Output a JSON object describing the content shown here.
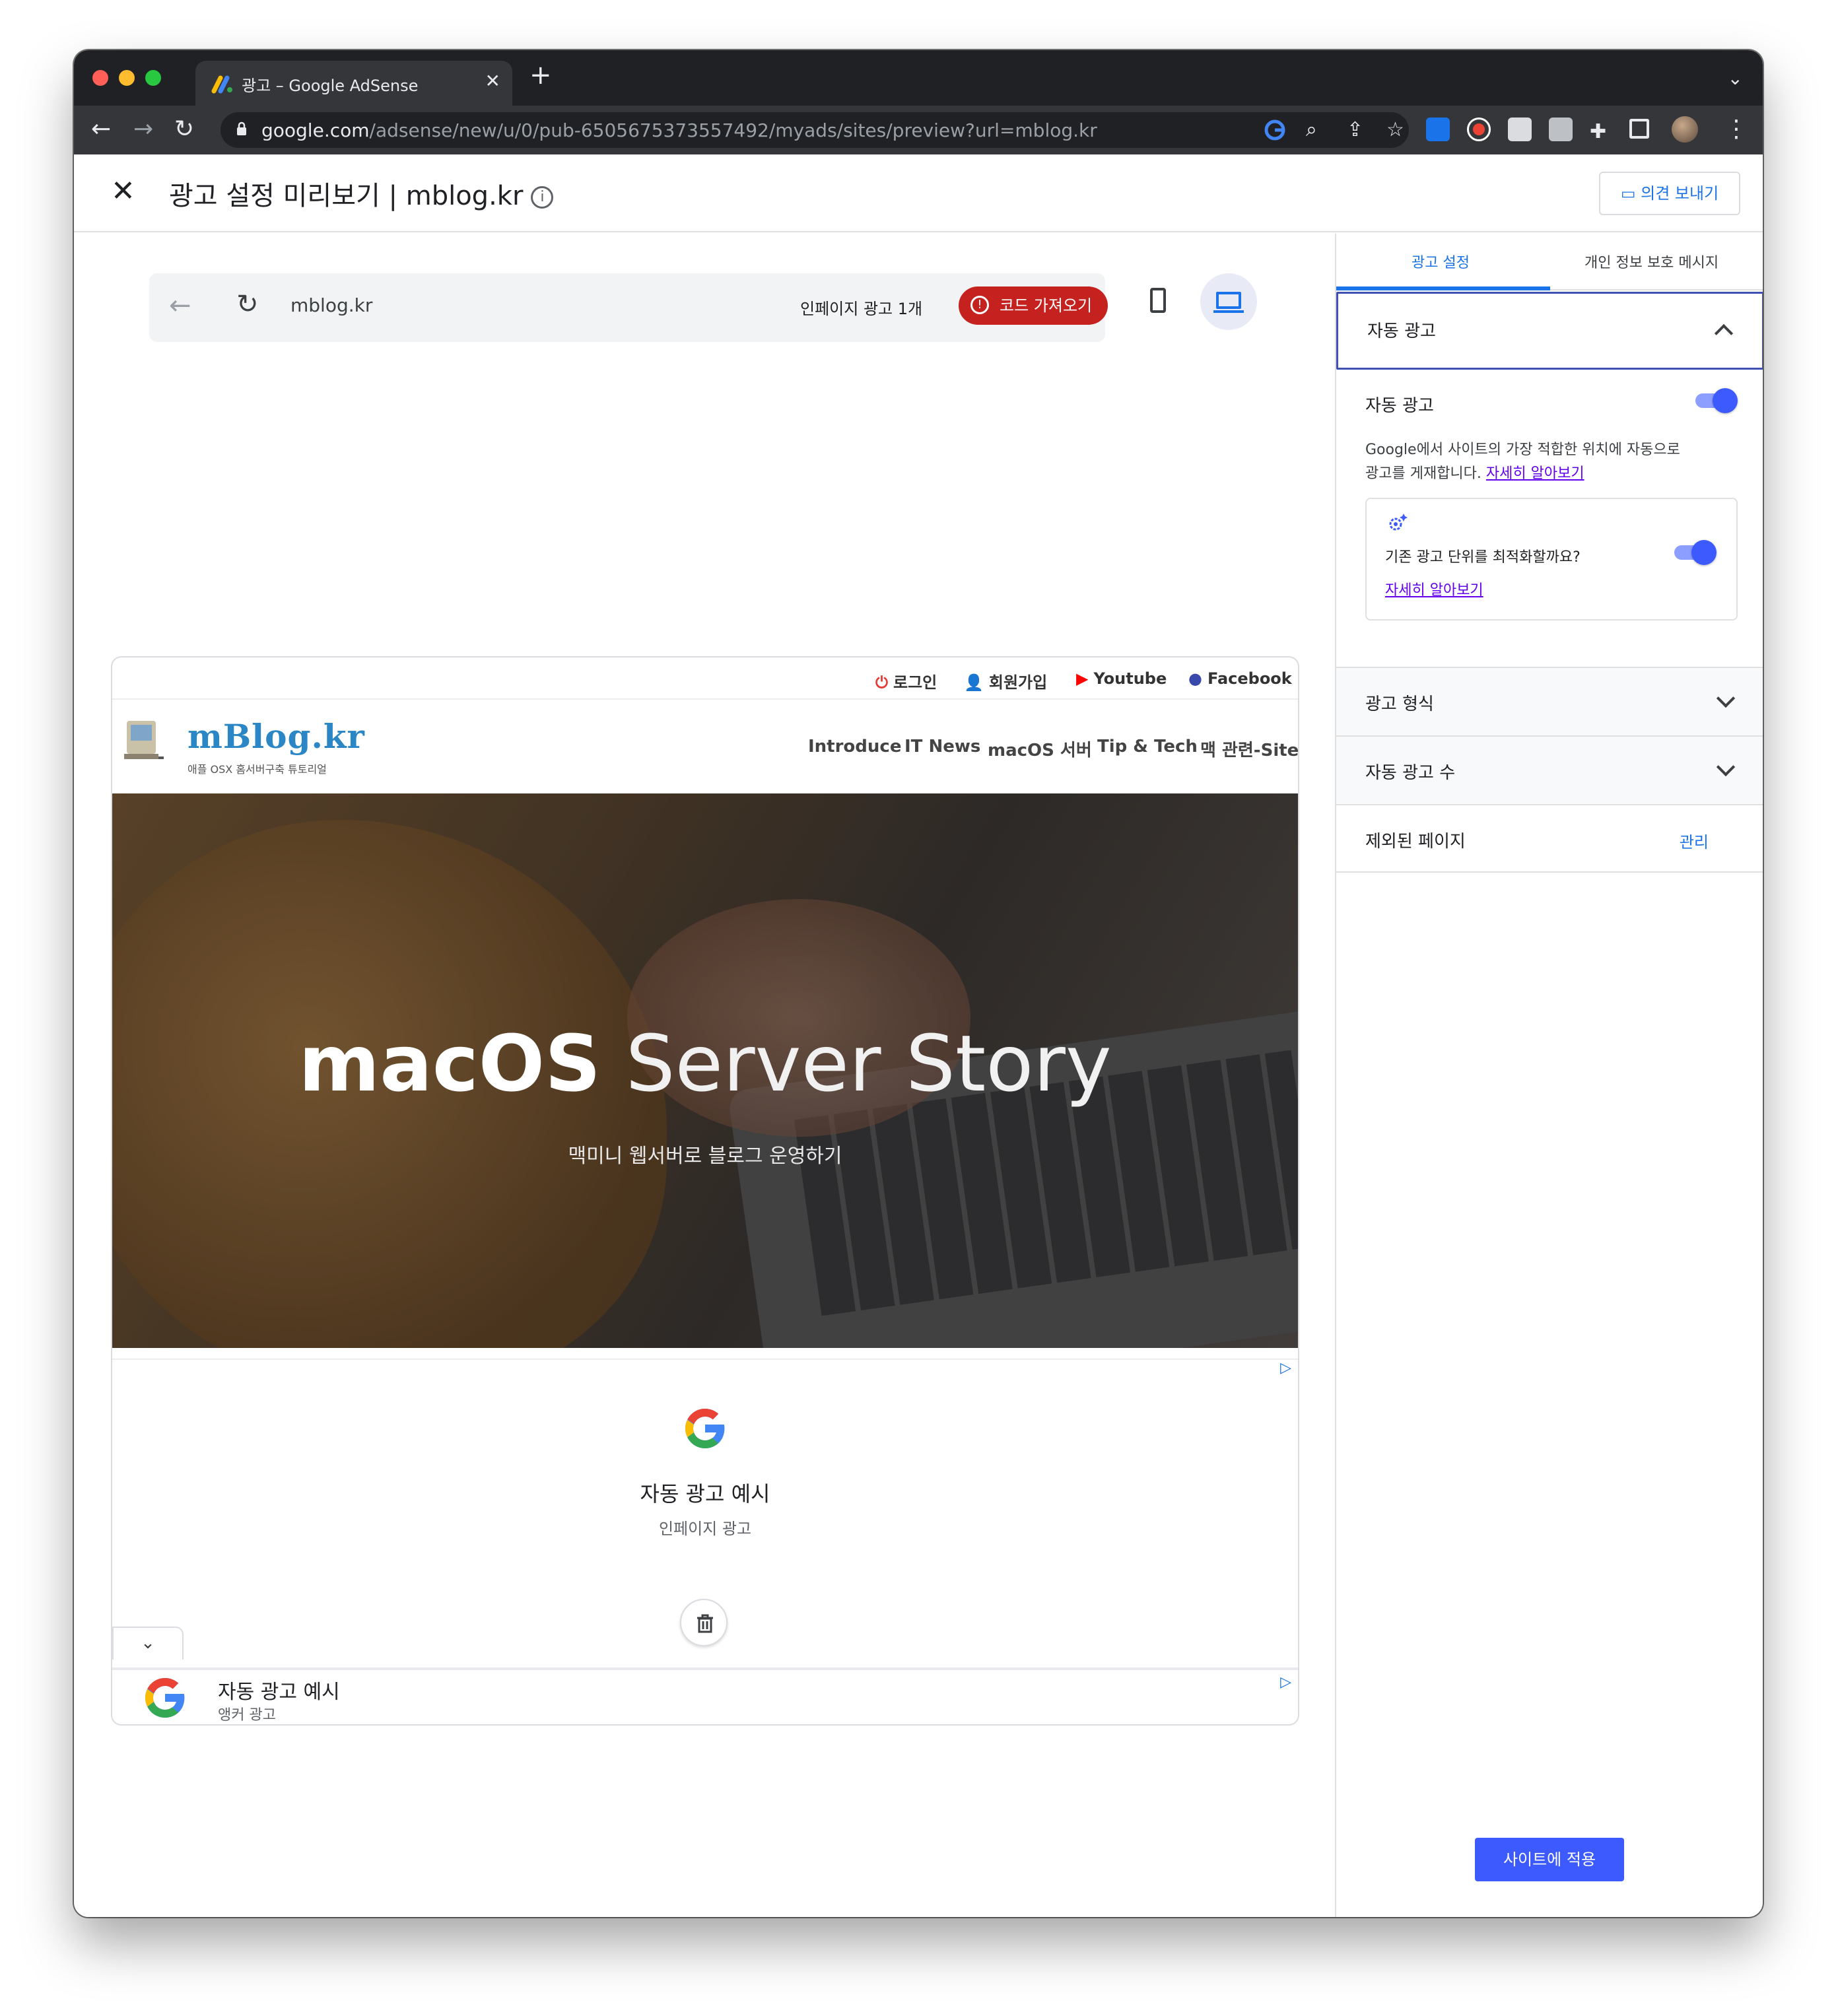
{
  "browser": {
    "tab_title": "광고 – Google AdSense",
    "url_host": "google.com",
    "url_path": "/adsense/new/u/0/pub-6505675373557492/myads/sites/preview?url=mblog.kr"
  },
  "header": {
    "title": "광고 설정 미리보기 | mblog.kr",
    "feedback_label": "의견 보내기"
  },
  "preview_bar": {
    "url": "mblog.kr",
    "ad_count": "인페이지 광고 1개",
    "get_code_label": "코드 가져오기"
  },
  "site": {
    "top_links": [
      "로그인",
      "회원가입",
      "Youtube",
      "Facebook"
    ],
    "brand": "mBlog.kr",
    "brand_sub": "애플 OSX 홈서버구축 튜토리얼",
    "menu": [
      "Introduce",
      "IT News",
      "macOS 서버",
      "Tip & Tech",
      "맥 관련-Site"
    ],
    "hero_title_bold": "macOS",
    "hero_title_light": "Server Story",
    "hero_sub": "맥미니 웹서버로 블로그 운영하기",
    "inpage_ad": {
      "title": "자동 광고 예시",
      "sub": "인페이지 광고"
    },
    "anchor_ad": {
      "title": "자동 광고 예시",
      "sub": "앵커 광고"
    }
  },
  "sidebar": {
    "tabs": [
      "광고 설정",
      "개인 정보 보호 메시지"
    ],
    "auto_ads_section": "자동 광고",
    "auto_ads_label": "자동 광고",
    "auto_ads_desc": "Google에서 사이트의 가장 적합한 위치에 자동으로 광고를 게재합니다.",
    "learn_more": "자세히 알아보기",
    "optimize_label": "기존 광고 단위를 최적화할까요?",
    "optimize_learn_more": "자세히 알아보기",
    "ad_formats": "광고 형식",
    "ad_load": "자동 광고 수",
    "excluded_pages": "제외된 페이지",
    "manage_label": "관리",
    "apply_label": "사이트에 적용"
  },
  "colors": {
    "accent": "#1a73e8",
    "toggle": "#3d5afe",
    "danger": "#c5221f",
    "brand": "#2b86c5"
  }
}
